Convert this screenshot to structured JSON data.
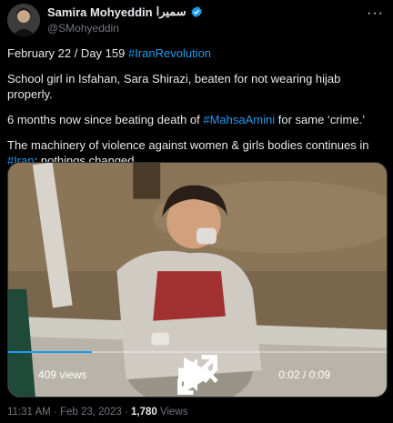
{
  "author": {
    "name": "Samira Mohyeddin",
    "name_native": "سمیرا",
    "handle": "@SMohyeddin"
  },
  "tweet": {
    "line1_prefix": "February 22 / Day 159 ",
    "line1_hashtag": "#IranRevolution",
    "line2": "School girl in Isfahan, Sara Shirazi, beaten for not wearing hijab properly.",
    "line3_prefix": "6 months now since beating death of ",
    "line3_hashtag": "#MahsaAmini",
    "line3_suffix": " for same ‘crime.’",
    "line4_prefix": "The machinery of violence against women & girls bodies continues in ",
    "line4_hashtag": "#Iran",
    "line4_suffix": "; nothings changed."
  },
  "video": {
    "views": "409 views",
    "time": "0:02 / 0:09",
    "progress": 0.22
  },
  "meta": {
    "time": "11:31 AM",
    "sep": " · ",
    "date": "Feb 23, 2023",
    "views_count": "1,780",
    "views_label": " Views"
  },
  "colors": {
    "accent": "#1d9bf0",
    "text": "#e7e9ea",
    "muted": "#71767b"
  }
}
